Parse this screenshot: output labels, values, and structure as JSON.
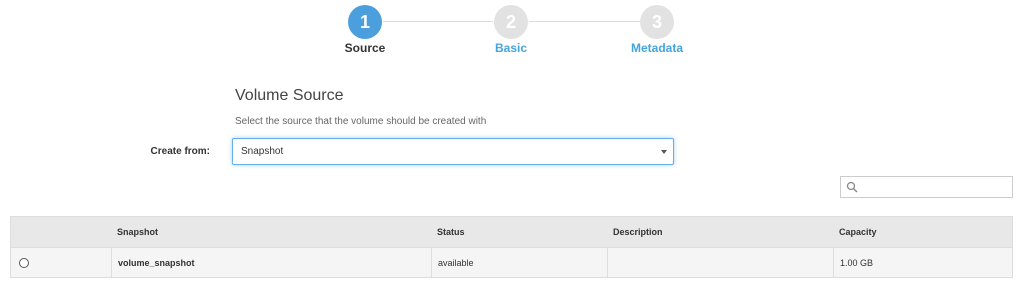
{
  "stepper": {
    "steps": [
      {
        "number": "1",
        "label": "Source",
        "active": true
      },
      {
        "number": "2",
        "label": "Basic",
        "active": false
      },
      {
        "number": "3",
        "label": "Metadata",
        "active": false
      }
    ]
  },
  "section": {
    "title": "Volume Source",
    "description": "Select the source that the volume should be created with"
  },
  "create_from": {
    "label": "Create from:",
    "selected": "Snapshot"
  },
  "search": {
    "placeholder": "",
    "icon": "search-icon"
  },
  "table": {
    "columns": [
      "Snapshot",
      "Status",
      "Description",
      "Capacity"
    ],
    "rows": [
      {
        "snapshot": "volume_snapshot",
        "status": "available",
        "description": "",
        "capacity": "1.00 GB"
      }
    ]
  },
  "colors": {
    "accent": "#4b9fdc",
    "link": "#45a4dc",
    "inactive_step": "#e2e2e2"
  }
}
